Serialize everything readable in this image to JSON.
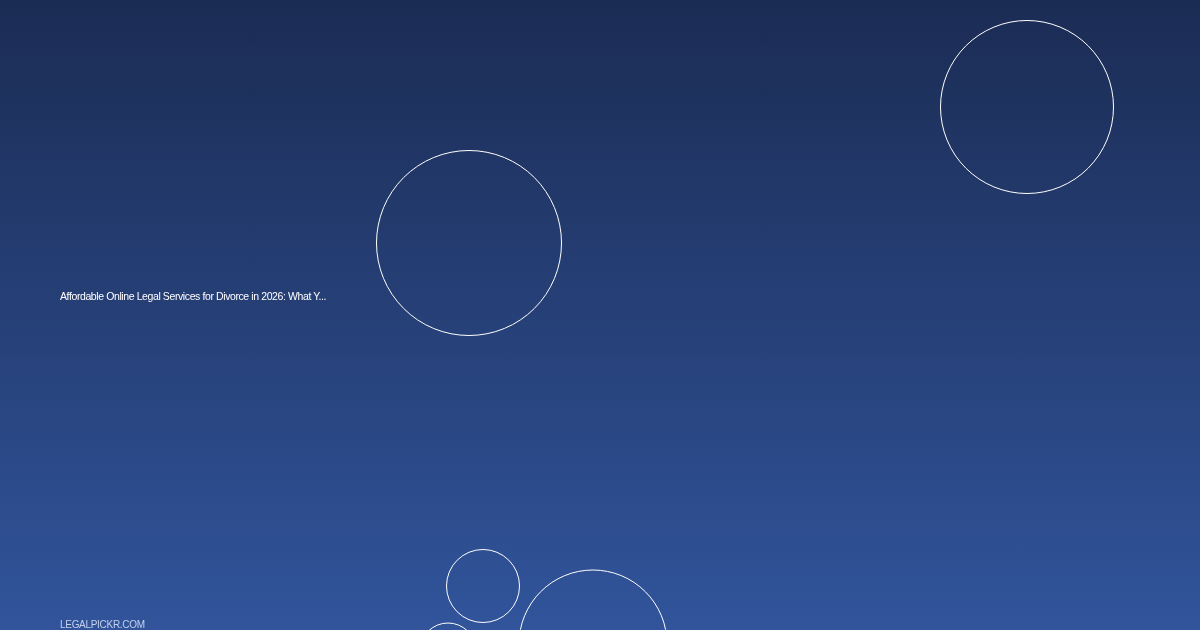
{
  "card": {
    "title": "Affordable Online Legal Services for Divorce in 2026: What Y...",
    "domain": "LEGALPICKR.COM"
  }
}
